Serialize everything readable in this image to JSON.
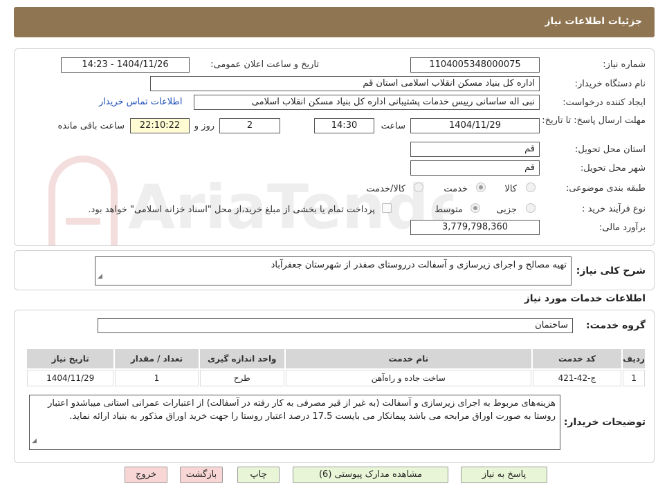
{
  "header": {
    "title": "جزئیات اطلاعات نیاز"
  },
  "watermark": {
    "text": "AriaTender.net"
  },
  "form": {
    "need_number_label": "شماره نیاز:",
    "need_number": "1104005348000075",
    "announce_label": "تاریخ و ساعت اعلان عمومی:",
    "announce_value": "1404/11/26 - 14:23",
    "buyer_org_label": "نام دستگاه خریدار:",
    "buyer_org": "اداره کل بنیاد مسکن انقلاب اسلامی استان قم",
    "creator_label": "ایجاد کننده درخواست:",
    "creator": "نبی اله ساسانی رییس خدمات پشتیبانی اداره کل بنیاد مسکن انقلاب اسلامی",
    "contact_link": "اطلاعات تماس خریدار",
    "deadline_label": "مهلت ارسال پاسخ: تا تاریخ:",
    "deadline_date": "1404/11/29",
    "time_label": "ساعت",
    "deadline_time": "14:30",
    "days_value": "2",
    "days_label": "روز و",
    "remaining_time": "22:10:22",
    "remaining_label": "ساعت باقی مانده",
    "province_label": "استان محل تحویل:",
    "province": "قم",
    "city_label": "شهر محل تحویل:",
    "city": "قم",
    "category_label": "طبقه بندی موضوعی:",
    "category_options": [
      "کالا",
      "خدمت",
      "کالا/خدمت"
    ],
    "process_label": "نوع فرآیند خرید :",
    "process_options": [
      "جزیی",
      "متوسط"
    ],
    "payment_note": "پرداخت تمام یا بخشی از مبلغ خرید،از محل \"اسناد خزانه اسلامی\" خواهد بود.",
    "budget_label": "برآورد مالی:",
    "budget": "3,779,798,360"
  },
  "description": {
    "label": "شرح کلی نیاز:",
    "text": "تهیه مصالح و اجرای زیرسازی و آسفالت درروستای صفدر از شهرستان جعفرآباد"
  },
  "services": {
    "title": "اطلاعات خدمات مورد نیاز",
    "group_label": "گروه خدمت:",
    "group_value": "ساختمان",
    "columns": [
      "ردیف",
      "کد خدمت",
      "نام خدمت",
      "واحد اندازه گیری",
      "تعداد / مقدار",
      "تاریخ نیاز"
    ],
    "rows": [
      [
        "1",
        "ج-42-421",
        "ساخت جاده و راه‌آهن",
        "طرح",
        "1",
        "1404/11/29"
      ]
    ]
  },
  "buyer_notes": {
    "label": "توضیحات خریدار:",
    "text": "هزینه‌های مربوط به اجرای زیرسازی و  آسفالت (به غیر از قیر مصرفی به کار رفته در آسفالت) از اعتبارات عمرانی استانی میباشدو اعتبار روستا به صورت اوراق مرابحه می باشد پیمانکار می بایست 17.5 درصد اعتبار روستا را جهت خرید اوراق مذکور به بنیاد ارائه نماید."
  },
  "buttons": {
    "reply": "پاسخ به نیاز",
    "attachments": "مشاهده مدارک پیوستی (6)",
    "print": "چاپ",
    "back": "بازگشت",
    "exit": "خروج"
  },
  "colors": {
    "header": "#8f7551",
    "button_green": "#e8f5d6",
    "button_pink": "#f9d6d6",
    "link": "#1e4fb8"
  }
}
